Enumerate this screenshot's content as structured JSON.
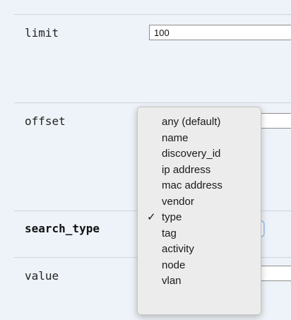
{
  "params": [
    {
      "name": "limit",
      "value": "100"
    },
    {
      "name": "offset",
      "value": ""
    },
    {
      "name": "search_type",
      "value": "type"
    },
    {
      "name": "value",
      "value": ""
    }
  ],
  "dropdown": {
    "options": [
      "any (default)",
      "name",
      "discovery_id",
      "ip address",
      "mac address",
      "vendor",
      "type",
      "tag",
      "activity",
      "node",
      "vlan"
    ],
    "selected": "type",
    "checkmark_glyph": "✓"
  }
}
